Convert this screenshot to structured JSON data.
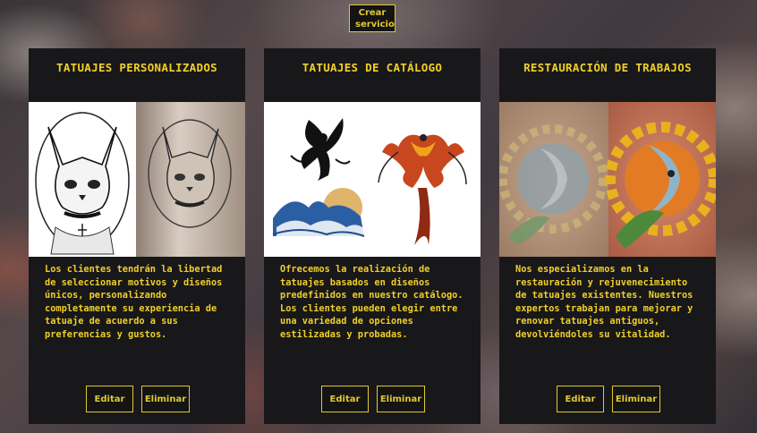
{
  "header": {
    "create_label": "Crear\nservicio"
  },
  "cards": [
    {
      "title": "TATUAJES PERSONALIZADOS",
      "image": "sphynx-cat-tattoo-sketch-and-arm",
      "description": "Los clientes tendrán la libertad de seleccionar motivos y diseños únicos, personalizando completamente su experiencia de tatuaje de acuerdo a sus preferencias y gustos.",
      "edit_label": "Editar",
      "delete_label": "Eliminar"
    },
    {
      "title": "TATUAJES DE CATÁLOGO",
      "image": "fairy-phoenix-wave-catalog-designs",
      "description": "Ofrecemos la realización de tatuajes basados en diseños predefinidos en nuestro catálogo. Los clientes pueden elegir entre una variedad de opciones estilizadas y probadas.",
      "edit_label": "Editar",
      "delete_label": "Eliminar"
    },
    {
      "title": "RESTAURACIÓN DE TRABAJOS",
      "image": "sun-moon-tattoo-before-after",
      "description": "Nos especializamos en la restauración y rejuvenecimiento de tatuajes existentes. Nuestros expertos trabajan para mejorar y renovar tatuajes antiguos, devolviéndoles su vitalidad.",
      "edit_label": "Editar",
      "delete_label": "Eliminar"
    }
  ],
  "colors": {
    "accent": "#f0cf2a",
    "card_bg": "#18181a"
  }
}
